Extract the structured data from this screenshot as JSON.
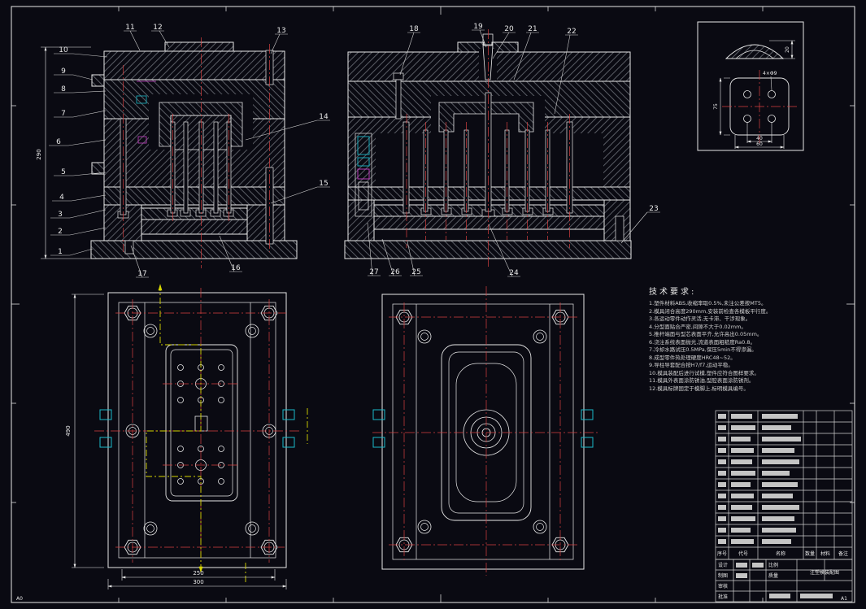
{
  "frame": {
    "zone_bl": "A0",
    "zone_br": "A1"
  },
  "callouts": {
    "c1": "1",
    "c2": "2",
    "c3": "3",
    "c4": "4",
    "c5": "5",
    "c6": "6",
    "c7": "7",
    "c8": "8",
    "c9": "9",
    "c10": "10",
    "c11": "11",
    "c12": "12",
    "c13": "13",
    "c14": "14",
    "c15": "15",
    "c16": "16",
    "c17": "17",
    "c18": "18",
    "c19": "19",
    "c20": "20",
    "c21": "21",
    "c22": "22",
    "c23": "23",
    "c24": "24",
    "c25": "25",
    "c26": "26",
    "c27": "27"
  },
  "dims": {
    "sec_left_height": "290",
    "plan_left_height": "490",
    "plan_left_inner_width": "250",
    "plan_left_outer_width": "300",
    "detail_hole_spacing": "40",
    "detail_width": "60",
    "detail_height": "75",
    "detail_cap_height": "20",
    "detail_holes_note": "4×Φ9"
  },
  "tech_requirements": {
    "title": "技术要求:",
    "lines": [
      "1.塑件材料ABS,收缩率取0.5%,未注公差按MT5。",
      "2.模具闭合高度290mm,安装前检查各模板平行度。",
      "3.各运动零件动作灵活,无卡滞、干涉现象。",
      "4.分型面贴合严密,间隙不大于0.02mm。",
      "5.推杆端面与型芯表面平齐,允许高出0.05mm。",
      "6.浇注系统表面抛光,流道表面粗糙度Ra0.8。",
      "7.冷却水路试压0.5MPa,保压5min不得渗漏。",
      "8.成型零件热处理硬度HRC48~52。",
      "9.导柱导套配合按H7/f7,运动平稳。",
      "10.模具装配后进行试模,塑件应符合图样要求。",
      "11.模具外表面涂防锈油,型腔表面涂防锈剂。",
      "12.模具标牌固定于模脚上,标明模具编号。"
    ]
  },
  "bom": {
    "headers": [
      "序号",
      "代号",
      "名称",
      "数量",
      "材料",
      "备注"
    ]
  },
  "title_block": {
    "rows": [
      "设计",
      "制图",
      "审核",
      "批准"
    ],
    "labels": {
      "scale": "比例",
      "weight": "质量"
    },
    "drawing_title": "注塑模装配图"
  }
}
